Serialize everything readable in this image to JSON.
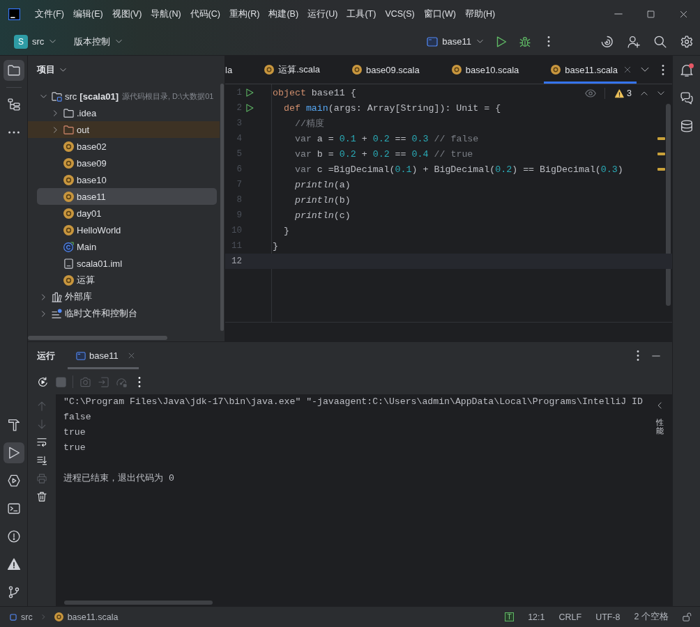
{
  "title_bar": {
    "menu": [
      "文件(F)",
      "编辑(E)",
      "视图(V)",
      "导航(N)",
      "代码(C)",
      "重构(R)",
      "构建(B)",
      "运行(U)",
      "工具(T)",
      "VCS(S)",
      "窗口(W)",
      "帮助(H)"
    ]
  },
  "main_toolbar": {
    "project": {
      "badge": "S",
      "name": "src"
    },
    "vcs": "版本控制",
    "run_configuration": "base11"
  },
  "left_toolbar": {
    "top": [
      {
        "kind": "project",
        "selected": true
      },
      {
        "kind": "structure",
        "selected": false
      },
      {
        "kind": "more",
        "selected": false
      }
    ],
    "bottom": [
      {
        "kind": "build",
        "selected": false
      },
      {
        "kind": "run",
        "selected": true
      },
      {
        "kind": "services",
        "selected": false
      },
      {
        "kind": "terminal",
        "selected": false
      },
      {
        "kind": "problems",
        "selected": false
      },
      {
        "kind": "warnings",
        "selected": false
      },
      {
        "kind": "vcs",
        "selected": false
      }
    ]
  },
  "right_toolbar": [
    {
      "kind": "notifications",
      "unread": true
    },
    {
      "kind": "ai-chat",
      "unread": false
    },
    {
      "kind": "database",
      "unread": false
    }
  ],
  "project_panel": {
    "title": "项目",
    "tree": [
      {
        "kind": "module-root",
        "name": "src",
        "module": "[scala01]",
        "hint": "源代码根目录, D:\\大数据01",
        "expanded": true,
        "selected": false,
        "children": [
          {
            "kind": "folder",
            "name": ".idea",
            "expanded": false,
            "selected": false
          },
          {
            "kind": "excluded-folder",
            "name": "out",
            "expanded": false,
            "selected": false
          },
          {
            "kind": "object",
            "name": "base02",
            "selected": false
          },
          {
            "kind": "object",
            "name": "base09",
            "selected": false
          },
          {
            "kind": "object",
            "name": "base10",
            "selected": false
          },
          {
            "kind": "object",
            "name": "base11",
            "selected": true
          },
          {
            "kind": "object",
            "name": "day01",
            "selected": false
          },
          {
            "kind": "object",
            "name": "HelloWorld",
            "selected": false
          },
          {
            "kind": "class",
            "name": "Main",
            "selected": false
          },
          {
            "kind": "iml",
            "name": "scala01.iml",
            "selected": false
          },
          {
            "kind": "object",
            "name": "运算",
            "selected": false
          }
        ]
      },
      {
        "kind": "library",
        "name": "外部库",
        "expanded": false,
        "selected": false
      },
      {
        "kind": "scratches",
        "name": "临时文件和控制台",
        "expanded": false,
        "selected": false
      }
    ]
  },
  "editor": {
    "tabs": [
      {
        "kind": "clipped",
        "label": "la",
        "selected": false
      },
      {
        "kind": "object",
        "label": "运算.scala",
        "selected": false
      },
      {
        "kind": "object",
        "label": "base09.scala",
        "selected": false
      },
      {
        "kind": "object",
        "label": "base10.scala",
        "selected": false
      },
      {
        "kind": "object",
        "label": "base11.scala",
        "selected": true
      }
    ],
    "inspection_count": "3",
    "lines": [
      {
        "number": "1",
        "run": true,
        "current": false,
        "warning": false,
        "tokens": [
          {
            "kind": "keyword",
            "text": "object"
          },
          {
            "kind": "plain",
            "text": " base11 {"
          }
        ]
      },
      {
        "number": "2",
        "run": true,
        "current": false,
        "warning": false,
        "tokens": [
          {
            "kind": "keyword",
            "text": "  def"
          },
          {
            "kind": "function",
            "text": " main"
          },
          {
            "kind": "plain",
            "text": "(args: Array[String]): Unit = {"
          }
        ]
      },
      {
        "number": "3",
        "run": false,
        "current": false,
        "warning": false,
        "tokens": [
          {
            "kind": "comment",
            "text": "    //精度"
          }
        ]
      },
      {
        "number": "4",
        "run": false,
        "current": false,
        "warning": true,
        "tokens": [
          {
            "kind": "dim",
            "text": "    var"
          },
          {
            "kind": "plain",
            "text": " a = "
          },
          {
            "kind": "number",
            "text": "0.1"
          },
          {
            "kind": "plain",
            "text": " + "
          },
          {
            "kind": "number",
            "text": "0.2"
          },
          {
            "kind": "plain",
            "text": " == "
          },
          {
            "kind": "number",
            "text": "0.3"
          },
          {
            "kind": "comment",
            "text": " // false"
          }
        ]
      },
      {
        "number": "5",
        "run": false,
        "current": false,
        "warning": true,
        "tokens": [
          {
            "kind": "dim",
            "text": "    var"
          },
          {
            "kind": "plain",
            "text": " b = "
          },
          {
            "kind": "number",
            "text": "0.2"
          },
          {
            "kind": "plain",
            "text": " + "
          },
          {
            "kind": "number",
            "text": "0.2"
          },
          {
            "kind": "plain",
            "text": " == "
          },
          {
            "kind": "number",
            "text": "0.4"
          },
          {
            "kind": "comment",
            "text": " // true"
          }
        ]
      },
      {
        "number": "6",
        "run": false,
        "current": false,
        "warning": true,
        "tokens": [
          {
            "kind": "dim",
            "text": "    var"
          },
          {
            "kind": "plain",
            "text": " c =BigDecimal("
          },
          {
            "kind": "number",
            "text": "0.1"
          },
          {
            "kind": "plain",
            "text": ") + BigDecimal("
          },
          {
            "kind": "number",
            "text": "0.2"
          },
          {
            "kind": "plain",
            "text": ") == BigDecimal("
          },
          {
            "kind": "number",
            "text": "0.3"
          },
          {
            "kind": "plain",
            "text": ")"
          }
        ]
      },
      {
        "number": "7",
        "run": false,
        "current": false,
        "warning": false,
        "tokens": [
          {
            "kind": "call",
            "text": "    println"
          },
          {
            "kind": "plain",
            "text": "(a)"
          }
        ]
      },
      {
        "number": "8",
        "run": false,
        "current": false,
        "warning": false,
        "tokens": [
          {
            "kind": "call",
            "text": "    println"
          },
          {
            "kind": "plain",
            "text": "(b)"
          }
        ]
      },
      {
        "number": "9",
        "run": false,
        "current": false,
        "warning": false,
        "tokens": [
          {
            "kind": "call",
            "text": "    println"
          },
          {
            "kind": "plain",
            "text": "(c)"
          }
        ]
      },
      {
        "number": "10",
        "run": false,
        "current": false,
        "warning": false,
        "tokens": [
          {
            "kind": "plain",
            "text": "  }"
          }
        ]
      },
      {
        "number": "11",
        "run": false,
        "current": false,
        "warning": false,
        "tokens": [
          {
            "kind": "plain",
            "text": "}"
          }
        ]
      },
      {
        "number": "12",
        "run": false,
        "current": true,
        "warning": false
      }
    ]
  },
  "run_panel": {
    "title": "运行",
    "tabs": [
      {
        "label": "base11",
        "selected": true
      }
    ],
    "toolbar": [
      {
        "kind": "rerun",
        "disabled": false
      },
      {
        "kind": "stop",
        "disabled": true
      },
      {
        "kind": "screenshot",
        "disabled": true
      },
      {
        "kind": "exit",
        "disabled": true
      },
      {
        "kind": "profile",
        "disabled": true
      }
    ],
    "gutter": [
      {
        "kind": "up",
        "disabled": true
      },
      {
        "kind": "down",
        "disabled": true
      },
      {
        "kind": "wrap",
        "disabled": false
      },
      {
        "kind": "scroll-end",
        "disabled": false
      },
      {
        "kind": "print",
        "disabled": true
      },
      {
        "kind": "trash",
        "disabled": false
      }
    ],
    "console": [
      {
        "kind": "output",
        "text": "\"C:\\Program Files\\Java\\jdk-17\\bin\\java.exe\" \"-javaagent:C:\\Users\\admin\\AppData\\Local\\Programs\\IntelliJ ID"
      },
      {
        "kind": "output",
        "text": "false"
      },
      {
        "kind": "output",
        "text": "true"
      },
      {
        "kind": "output",
        "text": "true"
      },
      {
        "kind": "exit",
        "text": "进程已结束，退出代码为 0"
      }
    ],
    "side_tab": "性能"
  },
  "status_bar": {
    "breadcrumbs": [
      {
        "kind": "module",
        "label": "src"
      },
      {
        "kind": "object",
        "label": "base11.scala"
      }
    ],
    "plugin_badge": "T",
    "position": "12:1",
    "line_separator": "CRLF",
    "encoding": "UTF-8",
    "indent": "2 个空格",
    "read_only": false
  }
}
